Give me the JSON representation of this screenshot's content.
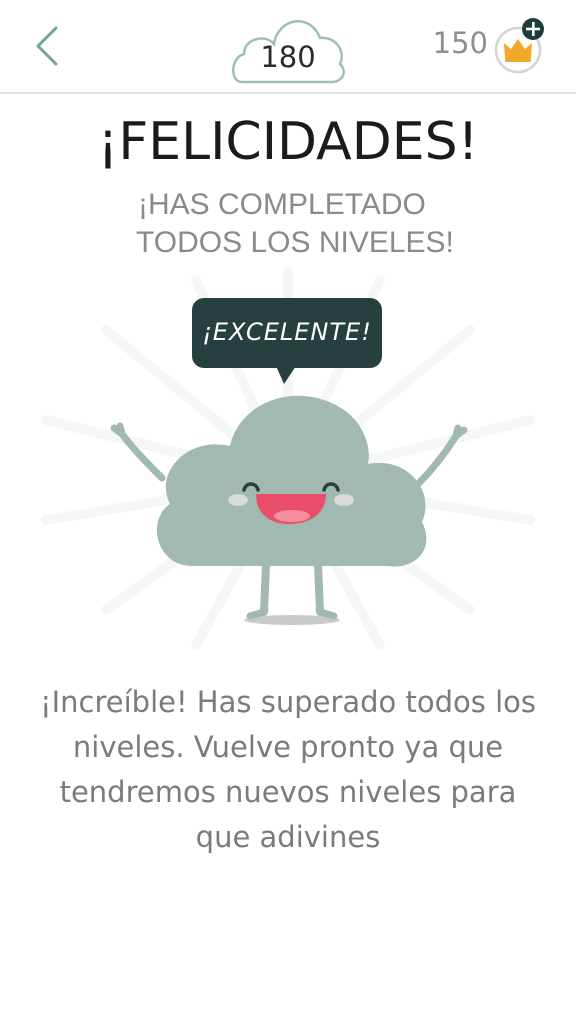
{
  "header": {
    "back_icon": "chevron-left-icon",
    "level_number": "180",
    "coins": "150",
    "crown_icon": "crown-icon",
    "add_icon": "plus-icon",
    "colors": {
      "accent": "#5a9a8a",
      "crown": "#f0a92a",
      "dark": "#1f3f3f"
    }
  },
  "main": {
    "title": "¡FELICIDADES!",
    "subtitle_line1": "¡HAS COMPLETADO",
    "subtitle_line2": "TODOS LOS NIVELES!",
    "bubble_text": "¡EXCELENTE!",
    "message": "¡Increíble! Has superado todos los niveles. Vuelve pronto ya que tendremos nuevos niveles para que adivines"
  },
  "illustration": {
    "character": "smiling-cloud-icon",
    "cloud_color": "#a2b9b1",
    "bubble_color": "#25403f"
  }
}
